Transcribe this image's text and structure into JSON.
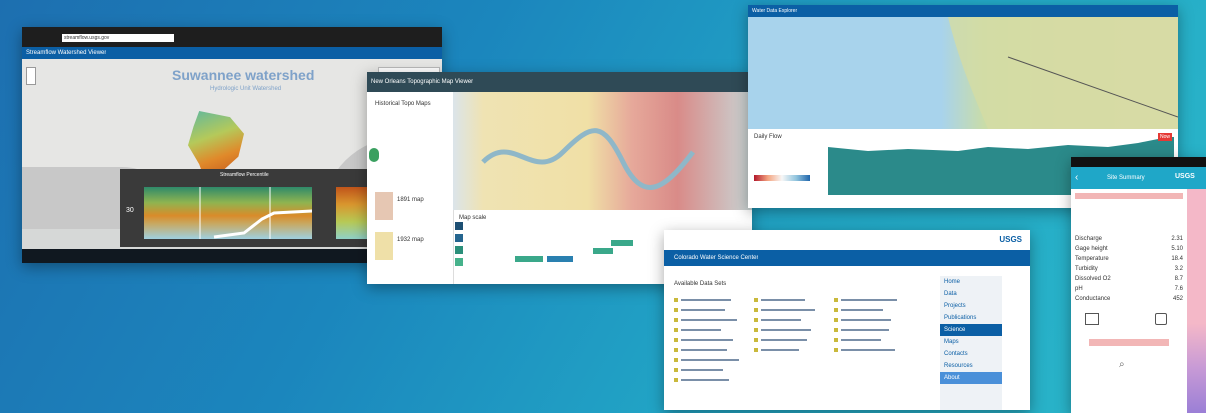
{
  "shot1": {
    "url": "streamflow.usgs.gov",
    "app_title": "Streamflow Watershed Viewer",
    "map_title": "Suwannee watershed",
    "map_subtitle": "Hydrologic Unit Watershed",
    "chart_caption": "Streamflow Percentile",
    "chart_y_value": "30"
  },
  "shot2": {
    "title": "New Orleans Topographic Map Viewer",
    "sidebar_heading": "Historical Topo Maps",
    "list_items": [
      "1891 map",
      "1932 map"
    ],
    "timeline_label": "Map scale"
  },
  "shot3": {
    "title": "Water Data Explorer",
    "chart_label": "Daily Flow",
    "badge": "Now"
  },
  "shot4": {
    "logo": "USGS",
    "header": "Colorado Water Science Center",
    "section": "Available Data Sets",
    "sidebar_items": [
      "Home",
      "Data",
      "Projects",
      "Publications",
      "Science",
      "Maps",
      "Contacts",
      "Resources",
      "About"
    ]
  },
  "shot5": {
    "nav_title": "Site Summary",
    "logo": "USGS",
    "rows": [
      "Discharge",
      "Gage height",
      "Temperature",
      "Turbidity",
      "Dissolved O2",
      "pH",
      "Conductance"
    ],
    "values": [
      "2.31",
      "5.10",
      "18.4",
      "3.2",
      "8.7",
      "7.6",
      "452"
    ]
  },
  "colors": {
    "usgs_blue": "#0b5fa5",
    "bg_start": "#1d6fb0",
    "bg_end": "#2bb7c9"
  }
}
